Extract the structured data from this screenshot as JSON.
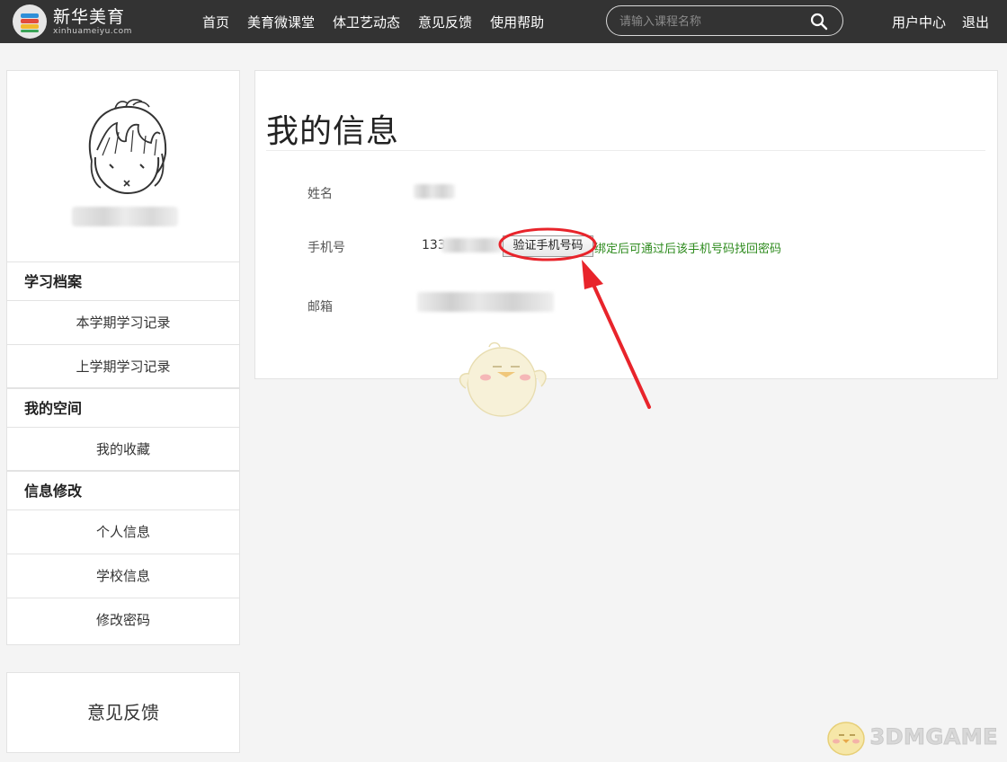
{
  "brand": {
    "name": "新华美育",
    "domain": "xinhuameiyu.com"
  },
  "nav": {
    "items": [
      "首页",
      "美育微课堂",
      "体卫艺动态",
      "意见反馈",
      "使用帮助"
    ]
  },
  "search": {
    "placeholder": "请输入课程名称",
    "icon": "search-icon"
  },
  "user_menu": {
    "center": "用户中心",
    "logout": "退出"
  },
  "sidebar": {
    "sections": [
      {
        "title": "学习档案",
        "items": [
          "本学期学习记录",
          "上学期学习记录"
        ]
      },
      {
        "title": "我的空间",
        "items": [
          "我的收藏"
        ]
      },
      {
        "title": "信息修改",
        "items": [
          "个人信息",
          "学校信息",
          "修改密码"
        ]
      }
    ]
  },
  "feedback": {
    "label": "意见反馈"
  },
  "main": {
    "title": "我的信息",
    "fields": {
      "name_label": "姓名",
      "phone_label": "手机号",
      "phone_prefix": "133",
      "email_label": "邮箱"
    },
    "verify_button": "验证手机号码",
    "hint": "绑定后可通过后该手机号码找回密码"
  },
  "watermark": {
    "text": "3DMGAME"
  },
  "colors": {
    "topbar": "#333333",
    "hint_green": "#2e8b1e",
    "annotation_red": "#e8242b"
  }
}
